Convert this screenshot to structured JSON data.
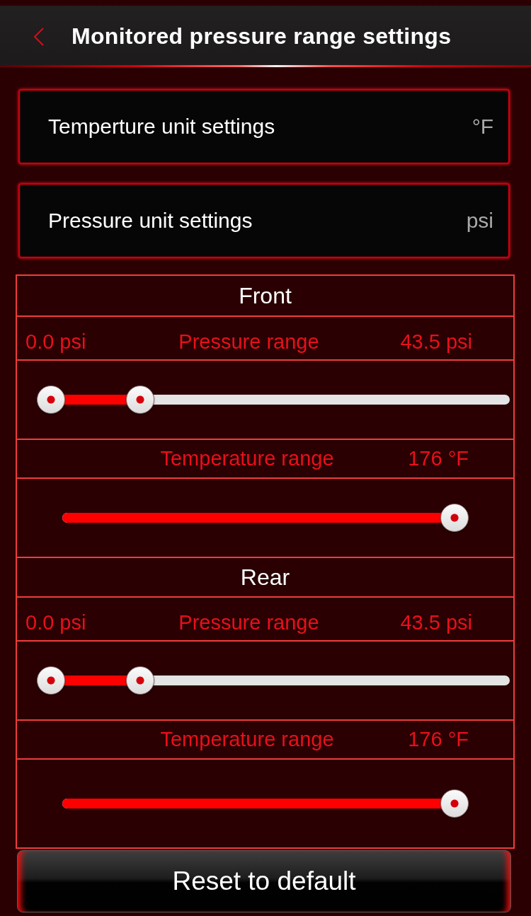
{
  "header": {
    "title": "Monitored pressure range settings"
  },
  "unit_settings": [
    {
      "label": "Temperture unit settings",
      "value": "°F"
    },
    {
      "label": "Pressure unit settings",
      "value": "psi"
    }
  ],
  "sections": [
    {
      "title": "Front",
      "pressure": {
        "min_reading": "0.0 psi",
        "label": "Pressure range",
        "max_reading": "43.5 psi",
        "thumbs": [
          {
            "level": 0
          },
          {
            "level": 0.2
          }
        ]
      },
      "temperature": {
        "label": "Temperature range",
        "reading": "176 °F",
        "level": 1
      }
    },
    {
      "title": "Rear",
      "pressure": {
        "min_reading": "0.0 psi",
        "label": "Pressure range",
        "max_reading": "43.5 psi",
        "thumbs": [
          {
            "level": 0
          },
          {
            "level": 0.2
          }
        ]
      },
      "temperature": {
        "label": "Temperature range",
        "reading": "176 °F",
        "level": 1
      }
    }
  ],
  "reset_button": {
    "label": "Reset to default"
  }
}
